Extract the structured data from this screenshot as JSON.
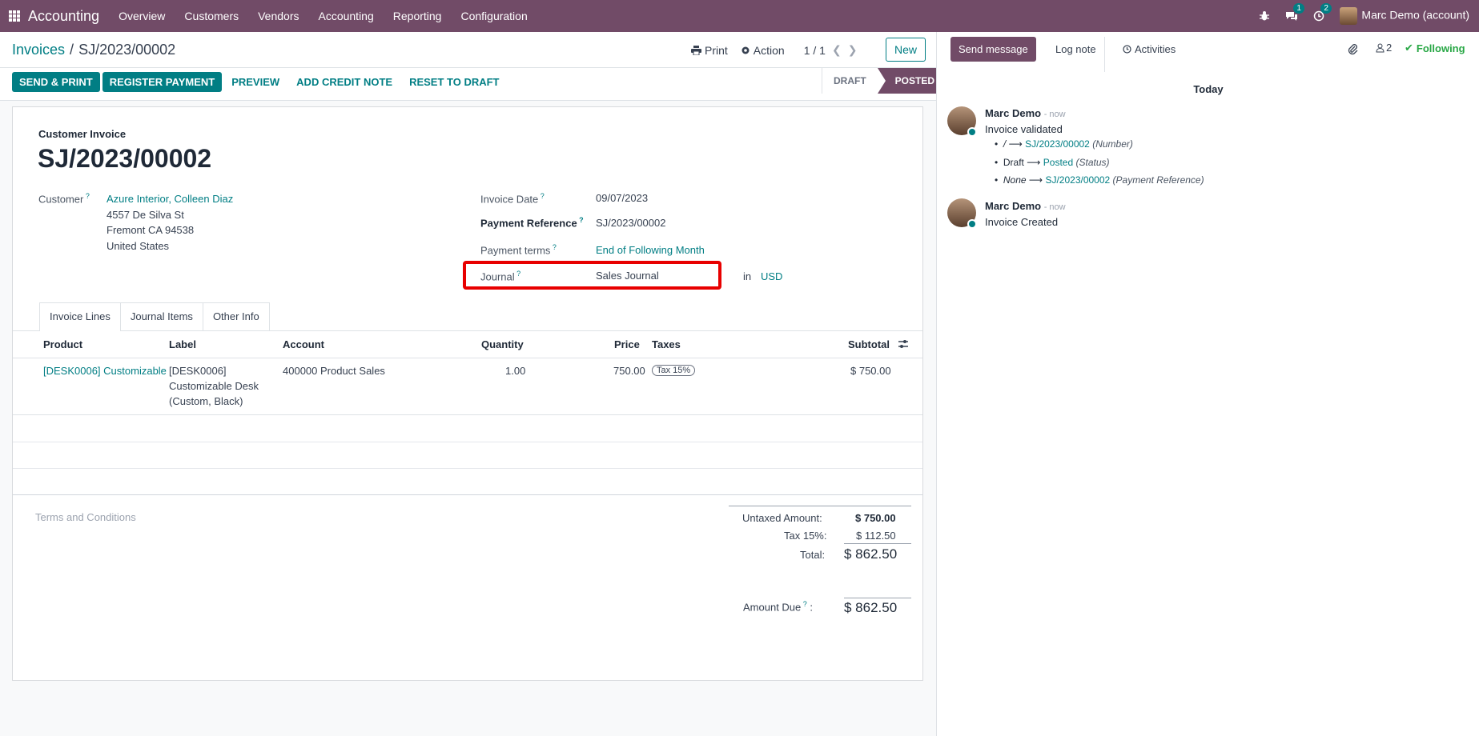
{
  "topbar": {
    "brand": "Accounting",
    "menu": [
      "Overview",
      "Customers",
      "Vendors",
      "Accounting",
      "Reporting",
      "Configuration"
    ],
    "chat_badge": "1",
    "activity_badge": "2",
    "user": "Marc Demo (account)"
  },
  "breadcrumb": {
    "parent": "Invoices",
    "sep": "/",
    "current": "SJ/2023/00002"
  },
  "control": {
    "print": "Print",
    "action": "Action",
    "pager": "1 / 1",
    "new": "New"
  },
  "buttons": {
    "send_print": "SEND & PRINT",
    "register_payment": "REGISTER PAYMENT",
    "preview": "PREVIEW",
    "add_credit_note": "ADD CREDIT NOTE",
    "reset_to_draft": "RESET TO DRAFT"
  },
  "status": {
    "draft": "DRAFT",
    "posted": "POSTED"
  },
  "invoice": {
    "type_label": "Customer Invoice",
    "number": "SJ/2023/00002",
    "customer_label": "Customer",
    "customer_name": "Azure Interior, Colleen Diaz",
    "addr1": "4557 De Silva St",
    "addr2": "Fremont CA 94538",
    "addr3": "United States",
    "invoice_date_label": "Invoice Date",
    "invoice_date": "09/07/2023",
    "payment_ref_label": "Payment Reference",
    "payment_ref": "SJ/2023/00002",
    "payment_terms_label": "Payment terms",
    "payment_terms": "End of Following Month",
    "journal_label": "Journal",
    "journal": "Sales Journal",
    "in": "in",
    "currency": "USD"
  },
  "tabs": [
    "Invoice Lines",
    "Journal Items",
    "Other Info"
  ],
  "table": {
    "headers": {
      "product": "Product",
      "label": "Label",
      "account": "Account",
      "quantity": "Quantity",
      "price": "Price",
      "taxes": "Taxes",
      "subtotal": "Subtotal"
    },
    "row": {
      "product": "[DESK0006] Customizable",
      "label1": "[DESK0006]",
      "label2": "Customizable Desk",
      "label3": "(Custom, Black)",
      "account": "400000 Product Sales",
      "quantity": "1.00",
      "price": "750.00",
      "tax": "Tax 15%",
      "subtotal": "$ 750.00"
    }
  },
  "terms": "Terms and Conditions",
  "totals": {
    "untaxed_label": "Untaxed Amount:",
    "untaxed": "$ 750.00",
    "tax_label": "Tax 15%:",
    "tax": "$ 112.50",
    "total_label": "Total:",
    "total": "$ 862.50",
    "due_label": "Amount Due",
    "due": "$ 862.50"
  },
  "chatter": {
    "send_message": "Send message",
    "log_note": "Log note",
    "activities": "Activities",
    "followers": "2",
    "following": "Following",
    "today": "Today",
    "msg1": {
      "author": "Marc Demo",
      "time": "- now",
      "text": "Invoice validated",
      "c1_old": "/",
      "c1_new": "SJ/2023/00002",
      "c1_field": "(Number)",
      "c2_old": "Draft",
      "c2_new": "Posted",
      "c2_field": "(Status)",
      "c3_old": "None",
      "c3_new": "SJ/2023/00002",
      "c3_field": "(Payment Reference)"
    },
    "msg2": {
      "author": "Marc Demo",
      "time": "- now",
      "text": "Invoice Created"
    }
  }
}
